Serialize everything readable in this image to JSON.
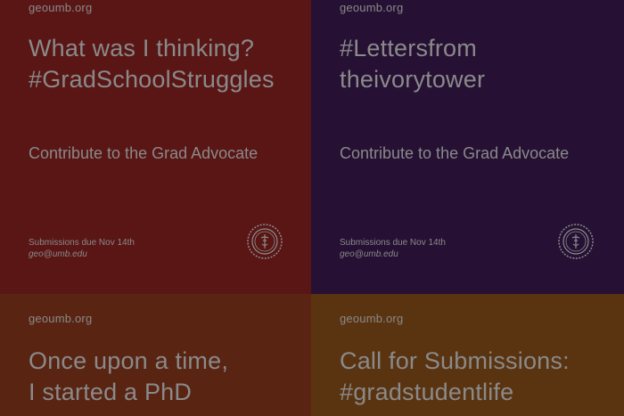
{
  "tiles": [
    {
      "site": "geoumb.org",
      "headline_lines": [
        "What was I thinking?",
        "#GradSchoolStruggles"
      ],
      "cta": "Contribute to the Grad Advocate",
      "due": "Submissions due Nov 14th",
      "email": "geo@umb.edu",
      "bg": "#5a1515"
    },
    {
      "site": "geoumb.org",
      "headline_lines": [
        "#Lettersfrom",
        "theivorytower"
      ],
      "cta": "Contribute to the Grad Advocate",
      "due": "Submissions due Nov 14th",
      "email": "geo@umb.edu",
      "bg": "#261033"
    },
    {
      "site": "geoumb.org",
      "headline_lines": [
        "Once upon a time,",
        "I started a PhD"
      ],
      "bg": "#5a2412"
    },
    {
      "site": "geoumb.org",
      "headline_lines": [
        "Call for Submissions:",
        "#gradstudentlife"
      ],
      "bg": "#5a3310"
    }
  ],
  "colors": {
    "text": "#8a8a8a",
    "seal_stroke": "#8c8c8c"
  },
  "icons": {
    "seal": "university-seal-icon"
  }
}
